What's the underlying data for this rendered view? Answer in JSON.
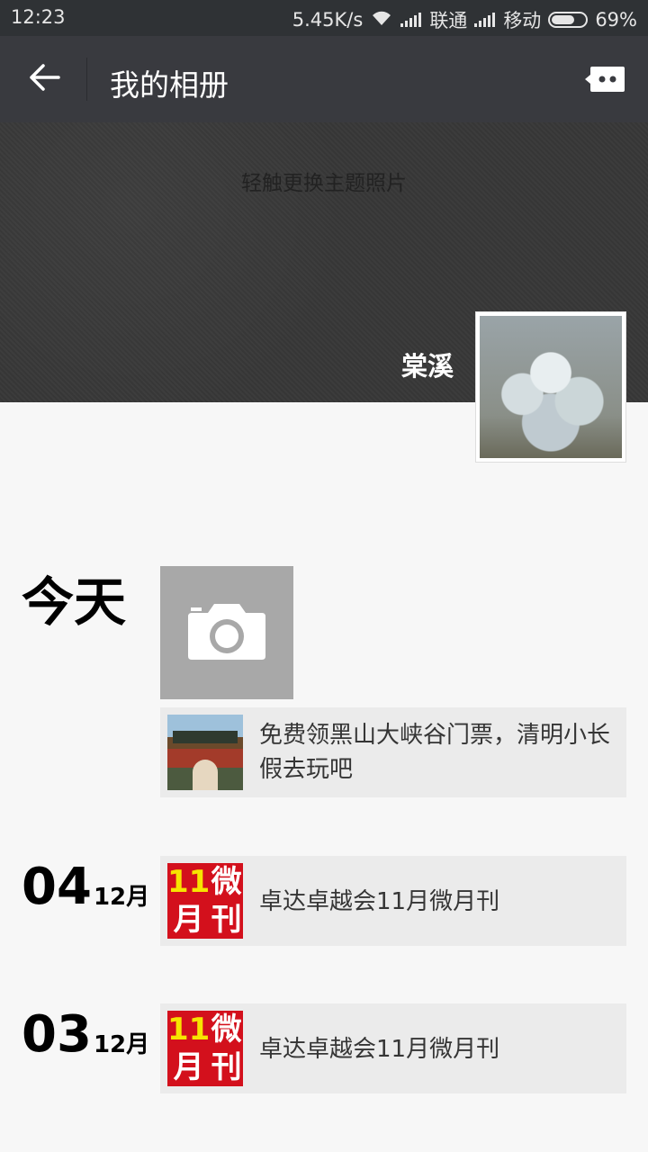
{
  "status_bar": {
    "time": "12:23",
    "net_speed": "5.45K/s",
    "carrier1": "联通",
    "carrier2": "移动",
    "battery": "69%",
    "battery_level": 0.69
  },
  "header": {
    "title": "我的相册",
    "back_icon": "arrow-left-icon",
    "more_icon": "more-bubble-icon"
  },
  "cover": {
    "hint": "轻触更换主题照片",
    "username": "棠溪"
  },
  "timeline": {
    "today_label": "今天",
    "camera_icon": "camera-icon",
    "entries": [
      {
        "day": "",
        "month": "",
        "text": "免费领黑山大峡谷门票，清明小长假去玩吧"
      },
      {
        "day": "04",
        "month": "12月",
        "text": "卓达卓越会11月微月刊"
      },
      {
        "day": "03",
        "month": "12月",
        "text": "卓达卓越会11月微月刊"
      }
    ],
    "magazine_thumb": {
      "c1": "11",
      "c2": "微",
      "c3": "月",
      "c4": "刊"
    }
  },
  "colors": {
    "title_bar": "#393a3f",
    "status_bar": "#2f3235",
    "background": "#f7f7f7",
    "item_bg": "#ebebeb",
    "magazine_red": "#d3101c"
  }
}
